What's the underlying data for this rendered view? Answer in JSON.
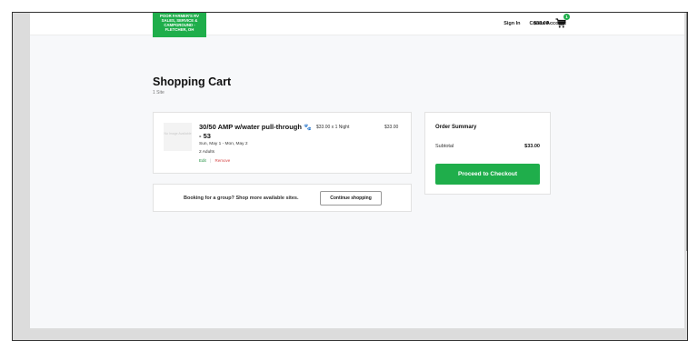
{
  "header": {
    "logo_lines": [
      "POOR FARMER'S RV",
      "SALES, SERVICE &",
      "CAMPGROUND -",
      "FLETCHER, OH"
    ],
    "sign_in": "Sign In",
    "create_account": "Create Account",
    "cart_total": "$33.00",
    "cart_count": "1",
    "cart_icon": "shopping-cart-icon"
  },
  "cart": {
    "title": "Shopping Cart",
    "subtitle": "1 Site",
    "item": {
      "thumbnail_text": "No Image Available",
      "name": "30/50 AMP w/water pull-through",
      "name_suffix": "- 53",
      "pet_icon": "paw-icon",
      "dates": "Sun, May 1 - Mon, May 2",
      "guests": "2 Adults",
      "edit": "Edit",
      "separator": "|",
      "remove": "Remove",
      "rate": "$33.00 x 1 Night",
      "price": "$33.00"
    },
    "group": {
      "text": "Booking for a group? Shop more available sites.",
      "button": "Continue shopping"
    }
  },
  "summary": {
    "title": "Order Summary",
    "subtotal_label": "Subtotal",
    "subtotal_value": "$33.00",
    "checkout_button": "Proceed to Checkout"
  },
  "colors": {
    "brand_green": "#1fae4b",
    "remove_red": "#d64545",
    "page_bg": "#f7f8fa"
  }
}
